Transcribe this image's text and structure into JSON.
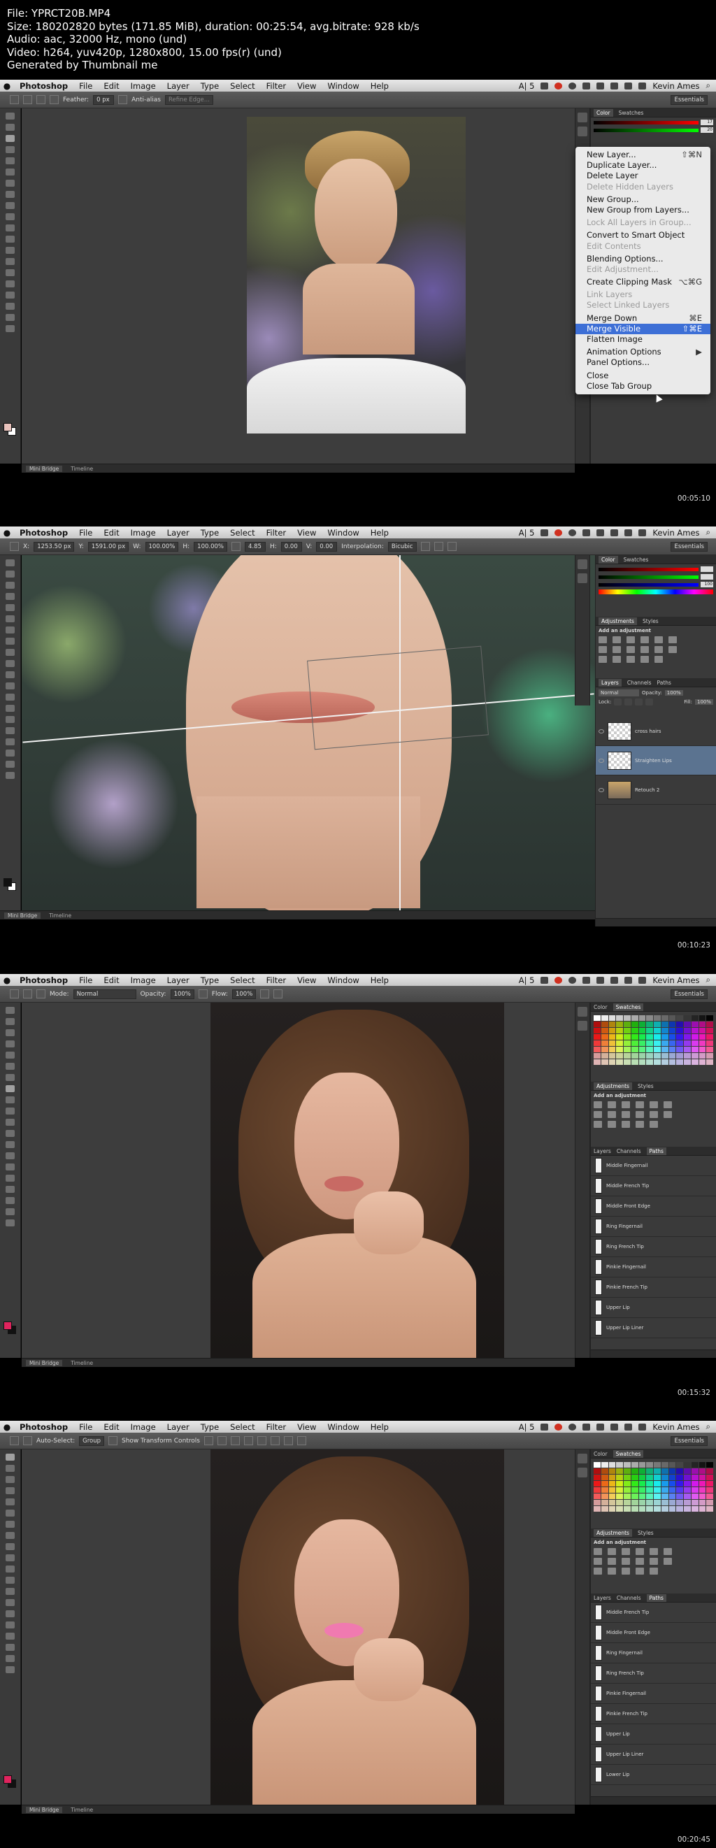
{
  "file_info": {
    "line1": "File: YPRCT20B.MP4",
    "line2": "Size: 180202820 bytes (171.85 MiB), duration: 00:25:54, avg.bitrate: 928 kb/s",
    "line3": "Audio: aac, 32000 Hz, mono (und)",
    "line4": "Video: h264, yuv420p, 1280x800, 15.00 fps(r) (und)",
    "line5": "Generated by Thumbnail me"
  },
  "menubar": {
    "app": "Photoshop",
    "items": [
      "File",
      "Edit",
      "Image",
      "Layer",
      "Type",
      "Select",
      "Filter",
      "View",
      "Window",
      "Help"
    ],
    "tray_text": "A| 5",
    "user": "Kevin Ames"
  },
  "frames": [
    {
      "timestamp": "00:05:10",
      "options": {
        "feather_label": "Feather:",
        "feather_value": "0 px",
        "antialias": "Anti-alias",
        "refine": "Refine Edge...",
        "workspace": "Essentials"
      },
      "status_tabs": [
        "Mini Bridge",
        "Timeline"
      ],
      "color_tabs": [
        "Color",
        "Swatches"
      ],
      "color_values": [
        "17",
        "20"
      ],
      "context_menu": [
        {
          "label": "New Layer...",
          "shortcut": "⇧⌘N",
          "state": "normal"
        },
        {
          "label": "Duplicate Layer...",
          "shortcut": "",
          "state": "normal"
        },
        {
          "label": "Delete Layer",
          "shortcut": "",
          "state": "normal"
        },
        {
          "label": "Delete Hidden Layers",
          "shortcut": "",
          "state": "disabled"
        },
        {
          "label": "",
          "shortcut": "",
          "state": "sep"
        },
        {
          "label": "New Group...",
          "shortcut": "",
          "state": "normal"
        },
        {
          "label": "New Group from Layers...",
          "shortcut": "",
          "state": "normal"
        },
        {
          "label": "",
          "shortcut": "",
          "state": "sep"
        },
        {
          "label": "Lock All Layers in Group...",
          "shortcut": "",
          "state": "disabled"
        },
        {
          "label": "",
          "shortcut": "",
          "state": "sep"
        },
        {
          "label": "Convert to Smart Object",
          "shortcut": "",
          "state": "normal"
        },
        {
          "label": "Edit Contents",
          "shortcut": "",
          "state": "disabled"
        },
        {
          "label": "",
          "shortcut": "",
          "state": "sep"
        },
        {
          "label": "Blending Options...",
          "shortcut": "",
          "state": "normal"
        },
        {
          "label": "Edit Adjustment...",
          "shortcut": "",
          "state": "disabled"
        },
        {
          "label": "",
          "shortcut": "",
          "state": "sep"
        },
        {
          "label": "Create Clipping Mask",
          "shortcut": "⌥⌘G",
          "state": "normal"
        },
        {
          "label": "",
          "shortcut": "",
          "state": "sep"
        },
        {
          "label": "Link Layers",
          "shortcut": "",
          "state": "disabled"
        },
        {
          "label": "Select Linked Layers",
          "shortcut": "",
          "state": "disabled"
        },
        {
          "label": "",
          "shortcut": "",
          "state": "sep"
        },
        {
          "label": "Merge Down",
          "shortcut": "⌘E",
          "state": "normal"
        },
        {
          "label": "Merge Visible",
          "shortcut": "⇧⌘E",
          "state": "highlight"
        },
        {
          "label": "Flatten Image",
          "shortcut": "",
          "state": "normal"
        },
        {
          "label": "",
          "shortcut": "",
          "state": "sep"
        },
        {
          "label": "Animation Options",
          "shortcut": "▶",
          "state": "normal"
        },
        {
          "label": "Panel Options...",
          "shortcut": "",
          "state": "normal"
        },
        {
          "label": "",
          "shortcut": "",
          "state": "sep"
        },
        {
          "label": "Close",
          "shortcut": "",
          "state": "normal"
        },
        {
          "label": "Close Tab Group",
          "shortcut": "",
          "state": "normal"
        }
      ]
    },
    {
      "timestamp": "00:10:23",
      "options": {
        "x_label": "X:",
        "x_value": "1253.50 px",
        "y_label": "Y:",
        "y_value": "1591.00 px",
        "w_label": "W:",
        "w_value": "100.00%",
        "h_label": "H:",
        "h_value": "100.00%",
        "angle_value": "4.85",
        "hskew_label": "H:",
        "hskew_value": "0.00",
        "vskew_label": "V:",
        "vskew_value": "0.00",
        "interp_label": "Interpolation:",
        "interp_value": "Bicubic",
        "workspace": "Essentials"
      },
      "status_tabs": [
        "Mini Bridge",
        "Timeline"
      ],
      "color_tabs": [
        "Color",
        "Swatches"
      ],
      "color_values": [
        "",
        "",
        "100"
      ],
      "adj_tabs": [
        "Adjustments",
        "Styles"
      ],
      "adj_title": "Add an adjustment",
      "layer_tabs": [
        "Layers",
        "Channels",
        "Paths"
      ],
      "blend_mode": "Normal",
      "opacity_label": "Opacity:",
      "opacity_value": "100%",
      "lock_label": "Lock:",
      "fill_label": "Fill:",
      "fill_value": "100%",
      "layers": [
        {
          "name": "cross hairs",
          "thumb": "checker",
          "selected": false
        },
        {
          "name": "Straighten Lips",
          "thumb": "checker",
          "selected": true
        },
        {
          "name": "Retouch 2",
          "thumb": "portrait",
          "selected": false
        }
      ]
    },
    {
      "timestamp": "00:15:32",
      "options": {
        "mode_label": "Mode:",
        "mode_value": "Normal",
        "opacity_label": "Opacity:",
        "opacity_value": "100%",
        "flow_label": "Flow:",
        "flow_value": "100%",
        "workspace": "Essentials"
      },
      "status_tabs": [
        "Mini Bridge",
        "Timeline"
      ],
      "color_tabs": [
        "Color",
        "Swatches"
      ],
      "adj_tabs": [
        "Adjustments",
        "Styles"
      ],
      "adj_title": "Add an adjustment",
      "path_tabs": [
        "Layers",
        "Channels",
        "Paths"
      ],
      "paths": [
        "Middle Fingernail",
        "Middle French Tip",
        "Middle Front Edge",
        "Ring Fingernail",
        "Ring French Tip",
        "Pinkie Fingernail",
        "Pinkie French Tip",
        "Upper Lip",
        "Upper Lip Liner"
      ]
    },
    {
      "timestamp": "00:20:45",
      "options": {
        "autoselect_label": "Auto-Select:",
        "autoselect_value": "Group",
        "transform_label": "Show Transform Controls",
        "workspace": "Essentials"
      },
      "status_tabs": [
        "Mini Bridge",
        "Timeline"
      ],
      "color_tabs": [
        "Color",
        "Swatches"
      ],
      "adj_tabs": [
        "Adjustments",
        "Styles"
      ],
      "adj_title": "Add an adjustment",
      "path_tabs": [
        "Layers",
        "Channels",
        "Paths"
      ],
      "paths": [
        "Middle French Tip",
        "Middle Front Edge",
        "Ring Fingernail",
        "Ring French Tip",
        "Pinkie Fingernail",
        "Pinkie French Tip",
        "Upper Lip",
        "Upper Lip Liner",
        "Lower Lip"
      ]
    }
  ],
  "colors": {
    "selection_blue": "#3d6fd6",
    "panel_bg": "#3a3a3a",
    "canvas_bg": "#3d3d3d",
    "fg_swatch_pink": "#e0245e"
  }
}
